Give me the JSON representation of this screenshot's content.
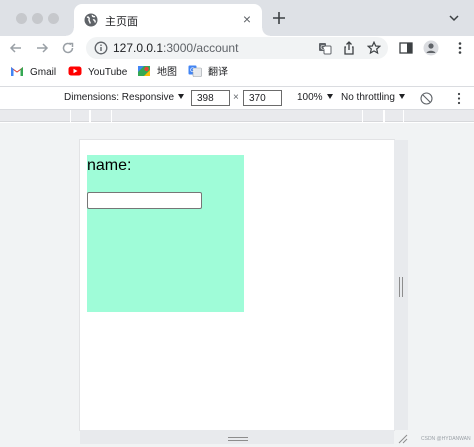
{
  "browser": {
    "tab": {
      "title": "主页面",
      "favicon": "globe-icon"
    },
    "address_bar": {
      "host": "127.0.0.1",
      "path": ":3000/account"
    }
  },
  "bookmarks": [
    {
      "label": "Gmail",
      "icon": "gmail-icon"
    },
    {
      "label": "YouTube",
      "icon": "youtube-icon"
    },
    {
      "label": "地图",
      "icon": "maps-icon"
    },
    {
      "label": "翻译",
      "icon": "translate-icon"
    }
  ],
  "device_toolbar": {
    "dimensions_label": "Dimensions: Responsive",
    "width": "398",
    "height": "370",
    "separator": "×",
    "zoom": "100%",
    "throttling": "No throttling"
  },
  "page": {
    "name_label": "name:",
    "name_value": "",
    "box_color": "#9ffcd8"
  },
  "watermark": "CSDN @HYDANWAN"
}
